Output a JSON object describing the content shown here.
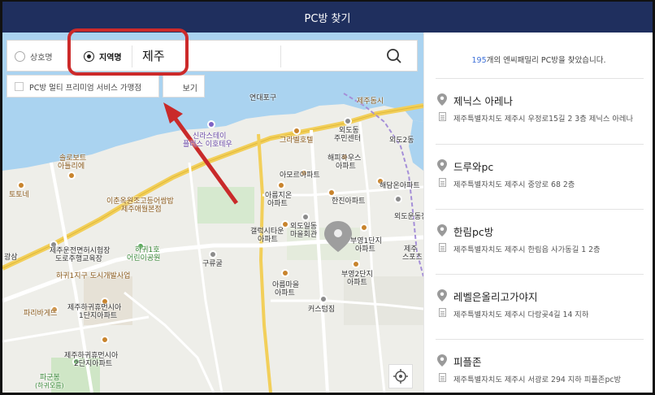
{
  "header": {
    "title": "PC방 찾기"
  },
  "search": {
    "option_name": "상호명",
    "option_region": "지역명",
    "selected_option": "지역명",
    "query": "제주",
    "filter_label": "PC방 멀티 프리미엄 서비스 가맹점",
    "filter_checked": false,
    "secondary_button": "보기"
  },
  "results": {
    "count": "195",
    "count_suffix": "개의 엔씨패밀리 PC방을 찾았습니다.",
    "items": [
      {
        "name": "제닉스 아레나",
        "address": "제주특별자치도 제주시 우정로15길 2 3층 제닉스 아레나"
      },
      {
        "name": "드루와pc",
        "address": "제주특별자치도 제주시 중앙로 68 2층"
      },
      {
        "name": "한림pc방",
        "address": "제주특별자치도 제주시 한림읍 사가동길 1 2층"
      },
      {
        "name": "레벨은올리고가야지",
        "address": "제주특별자치도 제주시 다랑곶4길 14 지하"
      },
      {
        "name": "피플존",
        "address": "제주특별자치도 제주시 서광로 294 지하 피플존pc방"
      }
    ]
  },
  "map": {
    "labels": {
      "yeondae": "연대포구",
      "jeju_sea": "제주돔시",
      "gallery": "그라벨호텔",
      "oedo_center1": "외도동",
      "oedo_center2": "주민센터",
      "oedo2": "외도2동",
      "haepi1": "해피하우스",
      "haepi2": "아파트",
      "amore": "아모르아파트",
      "areumji1": "아름지온",
      "areumji2": "아파트",
      "hanjin": "한진아파트",
      "haedamon": "해담온아파트",
      "oedo_dong": "외도운동장",
      "oedo_hall1": "외도일동",
      "oedo_hall2": "마을회관",
      "galaxy1": "갤럭시타운",
      "galaxy2": "아파트",
      "buyoung1_1": "부영1단지",
      "buyoung1_2": "아파트",
      "jeju_sports1": "제주",
      "jeju_sports2": "스포츠",
      "gurygul": "구류굴",
      "buyoung2_1": "부영2단지",
      "buyoung2_2": "아파트",
      "areum1": "아름마을",
      "areum2": "아파트",
      "customs": "커스텀짐",
      "sunbeach1": "신라스테이",
      "sunbeach2": "플러스 이호테우",
      "solo1": "솔로보트",
      "solo2": "아틀리에",
      "totone": "토토네",
      "ichun1": "이춘옥원조고등어쌈밥",
      "ichun2": "제주애월본점",
      "drive1": "제주운전면허시험장",
      "drive2": "도로주행교육장",
      "hagwi1": "하귀1호",
      "hagwi2": "어린이공원",
      "hagwi_plan": "하귀1지구 도시개발사업",
      "paris": "파리바게뜨",
      "hugh1_1": "제주하귀휴먼시아",
      "hugh1_2": "1단지아파트",
      "hugh2_1": "제주하귀휴먼시아",
      "hugh2_2": "2단지아파트",
      "pagun1": "파군봉",
      "pagun2": "(하귀오름)",
      "gwang": "광삼"
    }
  }
}
